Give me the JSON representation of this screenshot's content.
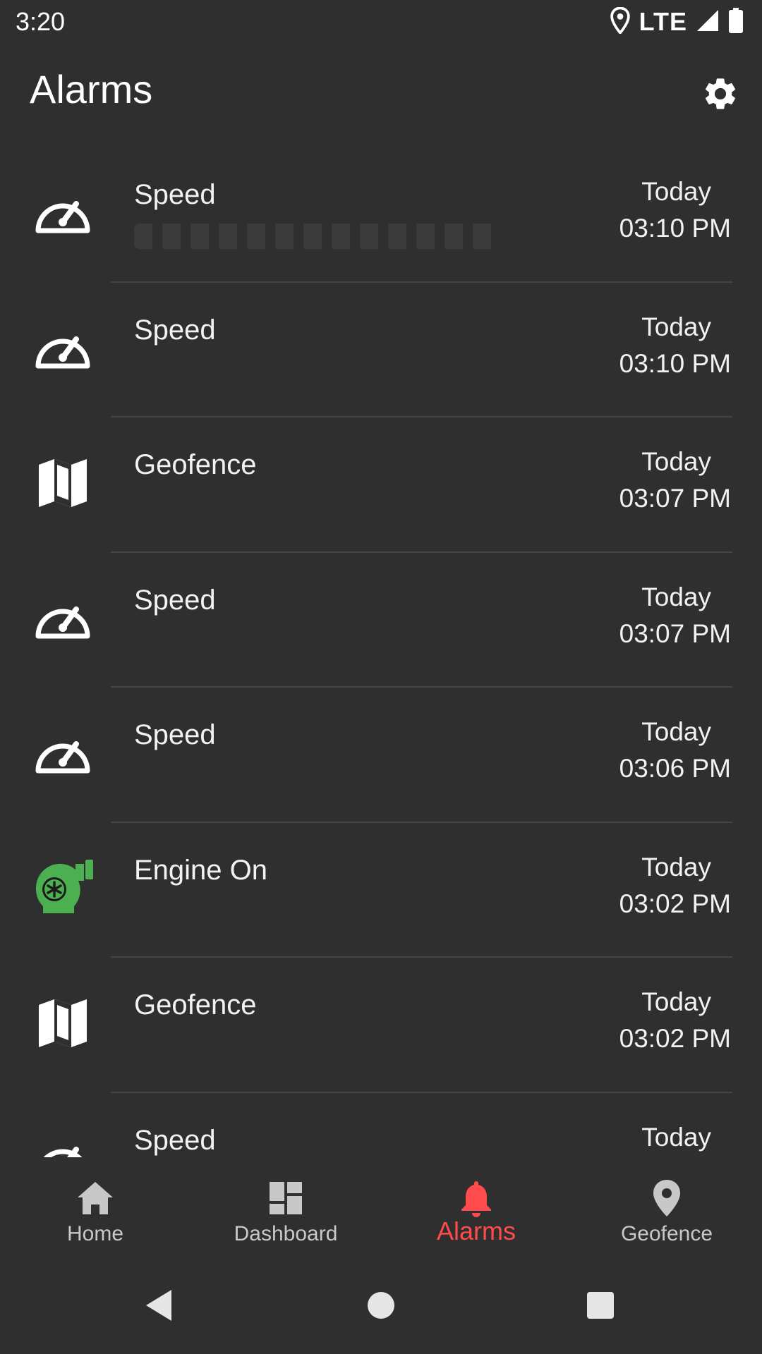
{
  "status_bar": {
    "time": "3:20",
    "network": "LTE",
    "icons": [
      "location-icon",
      "signal-icon",
      "battery-icon"
    ]
  },
  "app_bar": {
    "title": "Alarms",
    "settings_icon": "gear-icon"
  },
  "alarms": [
    {
      "type": "Speed",
      "icon": "speedometer-icon",
      "day": "Today",
      "time": "03:10 PM"
    },
    {
      "type": "Speed",
      "icon": "speedometer-icon",
      "day": "Today",
      "time": "03:10 PM"
    },
    {
      "type": "Geofence",
      "icon": "map-icon",
      "day": "Today",
      "time": "03:07 PM"
    },
    {
      "type": "Speed",
      "icon": "speedometer-icon",
      "day": "Today",
      "time": "03:07 PM"
    },
    {
      "type": "Speed",
      "icon": "speedometer-icon",
      "day": "Today",
      "time": "03:06 PM"
    },
    {
      "type": "Engine On",
      "icon": "engine-icon",
      "day": "Today",
      "time": "03:02 PM"
    },
    {
      "type": "Geofence",
      "icon": "map-icon",
      "day": "Today",
      "time": "03:02 PM"
    },
    {
      "type": "Speed",
      "icon": "speedometer-icon",
      "day": "Today",
      "time": ""
    }
  ],
  "bottom_nav": {
    "items": [
      {
        "label": "Home",
        "icon": "home-icon",
        "active": false
      },
      {
        "label": "Dashboard",
        "icon": "dashboard-icon",
        "active": false
      },
      {
        "label": "Alarms",
        "icon": "bell-icon",
        "active": true
      },
      {
        "label": "Geofence",
        "icon": "location-pin-icon",
        "active": false
      }
    ]
  },
  "colors": {
    "background": "#2f2f2f",
    "accent": "#ff4b4b",
    "engine_icon": "#4caf50",
    "text": "#ffffff",
    "nav_inactive": "#c8c8c8",
    "divider": "#444444"
  }
}
